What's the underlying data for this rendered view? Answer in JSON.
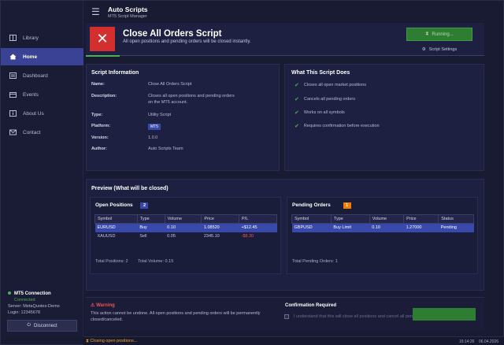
{
  "app": {
    "title": "Auto Scripts",
    "subtitle": "MT5 Script Manager"
  },
  "sidebar": {
    "items": [
      {
        "label": "Library",
        "icon": "book-icon",
        "active": false
      },
      {
        "label": "Home",
        "icon": "home-icon",
        "active": true
      },
      {
        "label": "Dashboard",
        "icon": "dashboard-icon",
        "active": false
      },
      {
        "label": "Events",
        "icon": "events-icon",
        "active": false
      },
      {
        "label": "About Us",
        "icon": "info-icon",
        "active": false
      },
      {
        "label": "Contact",
        "icon": "mail-icon",
        "active": false
      }
    ],
    "connection": {
      "title": "MT5 Connection",
      "status": "Connected",
      "server_label": "Server:",
      "server": "MetaQuotes-Demo",
      "login_label": "Login:",
      "login": "12345678"
    },
    "disconnect_label": "Disconnect"
  },
  "header": {
    "title": "Close All Orders Script",
    "subtitle": "All open positions and pending orders will be closed instantly.",
    "running_label": "Running...",
    "settings_label": "Script Settings"
  },
  "script_info": {
    "title": "Script Information",
    "name_key": "Name:",
    "name": "Close All Orders Script",
    "desc_key": "Description:",
    "description": "Closes all open positions and pending orders on the MT5 account.",
    "type_key": "Type:",
    "type": "Utility Script",
    "platform_key": "Platform:",
    "platform": "MT5",
    "version_key": "Version:",
    "version": "1.0.0",
    "author_key": "Author:",
    "author": "Auto Scripts Team"
  },
  "what_it_does": {
    "title": "What This Script Does",
    "items": [
      "Closes all open market positions",
      "Cancels all pending orders",
      "Works on all symbols",
      "Requires confirmation before execution"
    ]
  },
  "preview": {
    "title": "Preview  (What will be closed)",
    "open_positions": {
      "title": "Open Positions",
      "count": "2",
      "headers": [
        "Symbol",
        "Type",
        "Volume",
        "Price",
        "P/L"
      ],
      "rows": [
        [
          "EURUSD",
          "Buy",
          "0.10",
          "1.08520",
          "+$12.45"
        ],
        [
          "XAUUSD",
          "Sell",
          "0.05",
          "2345.10",
          "-$8.30"
        ]
      ],
      "total_positions": "Total Positions: 2",
      "total_volume": "Total Volume: 0.15"
    },
    "pending_orders": {
      "title": "Pending Orders",
      "count": "1",
      "headers": [
        "Symbol",
        "Type",
        "Volume",
        "Price",
        "Status"
      ],
      "rows": [
        [
          "GBPUSD",
          "Buy Limit",
          "0.10",
          "1.27000",
          "Pending"
        ]
      ],
      "total": "Total Pending Orders: 1"
    }
  },
  "warning": {
    "title": "Warning",
    "text": "This action cannot be undone. All open positions and pending orders will be permanently closed/canceled.",
    "confirm_title": "Confirmation Required",
    "confirm_text": "I understand that this will close all positions and cancel all pending orders."
  },
  "status_bar": {
    "message": "Closing open positions...",
    "time": "16:14:26",
    "date": "06.04.2026"
  },
  "colors": {
    "accent": "#3a4296",
    "danger": "#d32f2f",
    "success": "#2e7d32",
    "badge_orange": "#f57c00"
  }
}
